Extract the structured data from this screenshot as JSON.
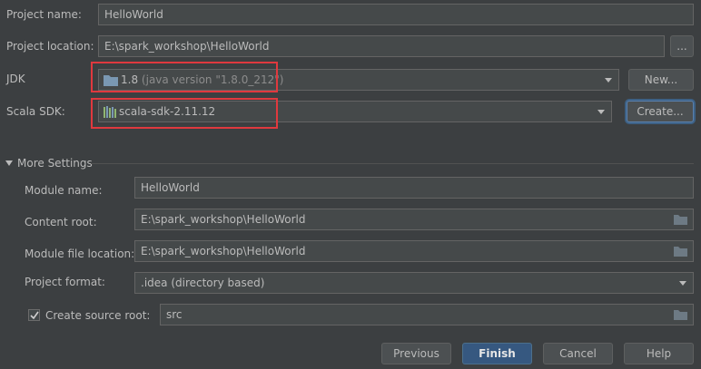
{
  "project": {
    "name_label": "Project name:",
    "name_value": "HelloWorld",
    "location_label": "Project location:",
    "location_value": "E:\\spark_workshop\\HelloWorld",
    "browse_label": "..."
  },
  "jdk": {
    "label": "JDK",
    "version": "1.8",
    "detail": "(java version \"1.8.0_212\")",
    "new_button": "New..."
  },
  "scala_sdk": {
    "label": "Scala SDK:",
    "value": "scala-sdk-2.11.12",
    "create_button": "Create..."
  },
  "more_settings": {
    "title": "More Settings",
    "module_name_label": "Module name:",
    "module_name_value": "HelloWorld",
    "content_root_label": "Content root:",
    "content_root_value": "E:\\spark_workshop\\HelloWorld",
    "module_file_label": "Module file location:",
    "module_file_value": "E:\\spark_workshop\\HelloWorld",
    "project_format_label": "Project format:",
    "project_format_value": ".idea (directory based)",
    "create_source_root_label": "Create source root:",
    "create_source_root_checked": true,
    "source_root_value": "src"
  },
  "footer": {
    "previous": "Previous",
    "finish": "Finish",
    "cancel": "Cancel",
    "help": "Help"
  },
  "colors": {
    "background": "#3c3f41",
    "highlight": "#e0393e",
    "primary_button": "#365880"
  }
}
